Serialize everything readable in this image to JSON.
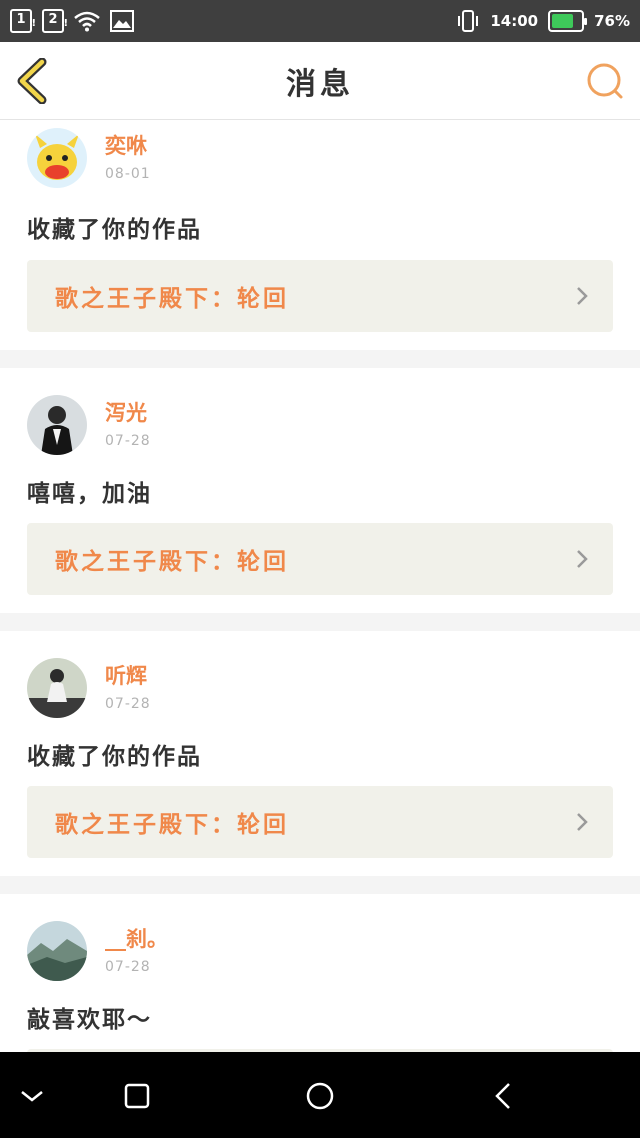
{
  "status_bar": {
    "sim1": "1",
    "sim2": "2",
    "time": "14:00",
    "battery": "76%",
    "battery_level": 0.76,
    "battery_color": "#3ec95a"
  },
  "header": {
    "title": "消息",
    "back_icon": "chevron-left-icon",
    "search_icon": "search-icon",
    "accent": "#f0884a"
  },
  "messages": [
    {
      "username": "奕咻",
      "date": "08-01",
      "text": "收藏了你的作品",
      "work": "歌之王子殿下：轮回"
    },
    {
      "username": "泻光",
      "date": "07-28",
      "text": "嘻嘻，加油",
      "work": "歌之王子殿下：轮回"
    },
    {
      "username": "听辉",
      "date": "07-28",
      "text": "收藏了你的作品",
      "work": "歌之王子殿下：轮回"
    },
    {
      "username": "__刹。",
      "date": "07-28",
      "text": "敲喜欢耶～",
      "work": ""
    }
  ],
  "nav_bar": {
    "icons": [
      "chevron-down-icon",
      "square-icon",
      "circle-icon",
      "back-triangle-icon"
    ]
  }
}
